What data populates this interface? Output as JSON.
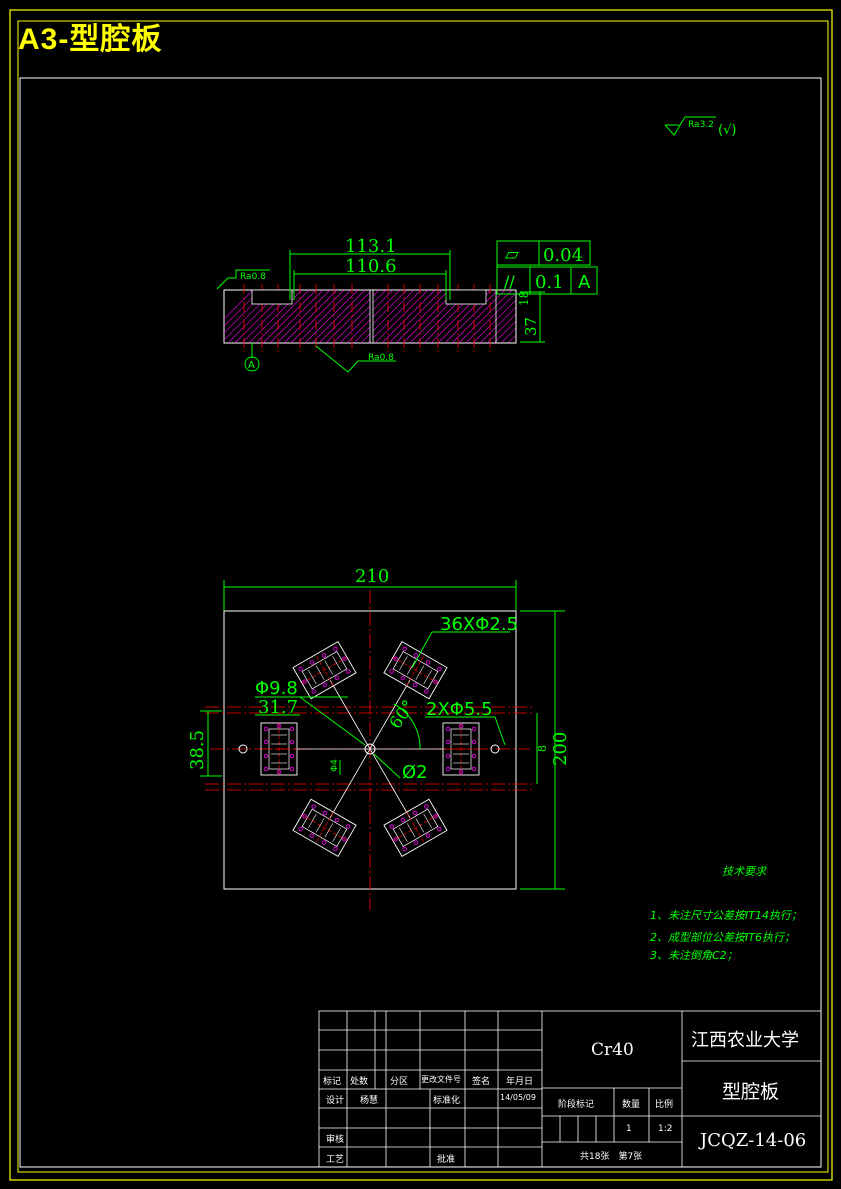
{
  "sheet": {
    "title": "A3-型腔板"
  },
  "surface_finish": {
    "general": "Ra3.2",
    "general_suffix": "(√)",
    "top_face": "Ra0.8",
    "bottom_face": "Ra0.8"
  },
  "section_view": {
    "dims": {
      "outer_length": "113.1",
      "inner_length": "110.6",
      "thickness_a": "37",
      "thickness_b": "18"
    },
    "tolerance_flatness": {
      "symbol": "▱",
      "value": "0.04"
    },
    "tolerance_parallel": {
      "symbol": "//",
      "value": "0.1",
      "datum": "A"
    },
    "datum_label": "A"
  },
  "plan_view": {
    "dims": {
      "width": "210",
      "height": "200",
      "holes_small": "36XΦ2.5",
      "hole_9_8": "Φ9.8",
      "dim_31_7": "31.7",
      "holes_large": "2XΦ5.5",
      "angle": "60°",
      "dim_38_5": "38.5",
      "dia_2": "Ø2",
      "dim_8": "8",
      "runner_4": "Φ4"
    }
  },
  "tech_requirements": {
    "heading": "技术要求",
    "items": [
      "1、未注尺寸公差按IT14执行；",
      "2、成型部位公差按IT6执行；",
      "3、未注倒角C2；"
    ]
  },
  "title_block": {
    "material": "Cr40",
    "school": "江西农业大学",
    "part_name": "型腔板",
    "drawing_no": "JCQZ-14-06",
    "header_labels": [
      "标记",
      "处数",
      "分区",
      "更改文件号",
      "签名",
      "年月日"
    ],
    "row_design": {
      "label": "设计",
      "name": "杨慧",
      "std_label": "标准化",
      "date": "14/05/09"
    },
    "row_review": "审核",
    "row_process": "工艺",
    "approve": "批准",
    "stage_label": "阶段标记",
    "qty_label": "数量",
    "scale_label": "比例",
    "qty": "1",
    "scale": "1:2",
    "sheets": "共18张　第7张"
  },
  "colors": {
    "frame": "#ffff00",
    "geometry": "#ffffff",
    "dimension": "#00ff00",
    "center": "#ff0000",
    "hidden": "#ff00ff"
  }
}
